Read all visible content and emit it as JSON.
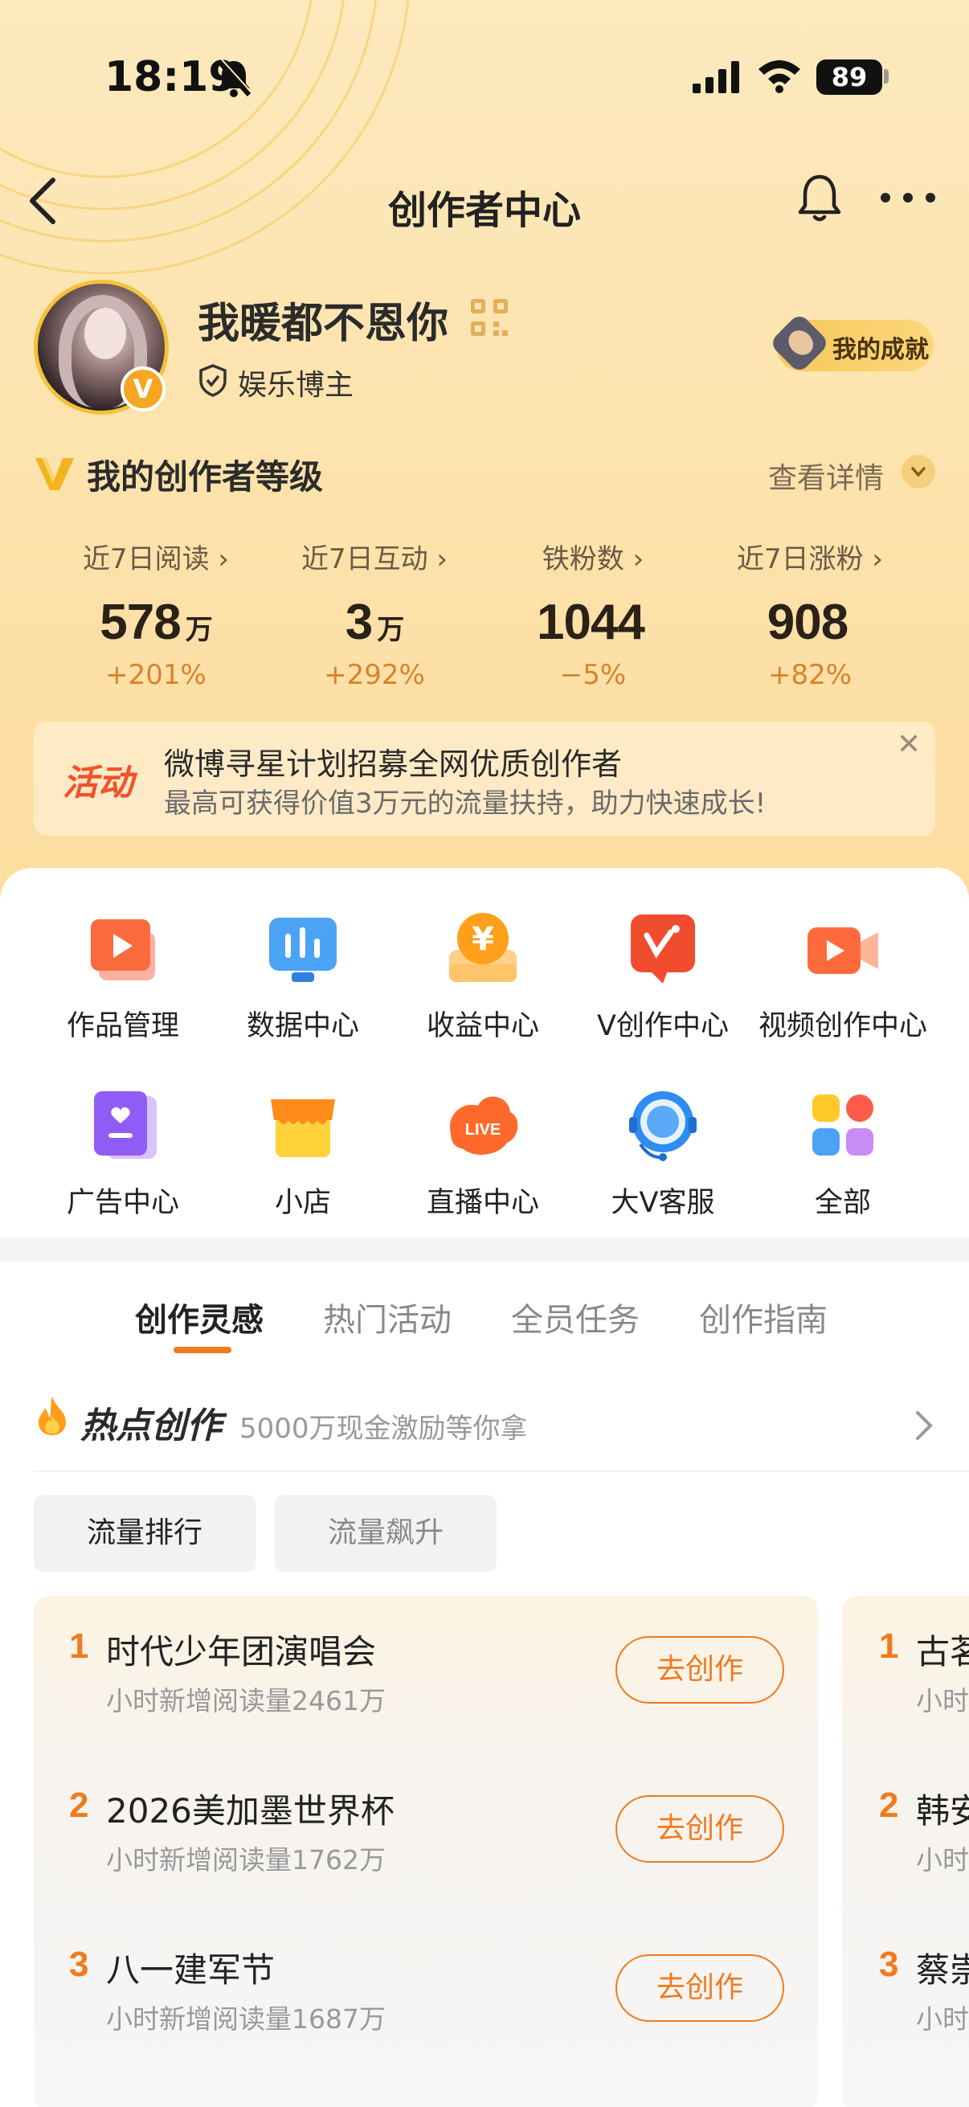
{
  "status_bar": {
    "time": "18:19",
    "battery": "89"
  },
  "nav": {
    "title": "创作者中心"
  },
  "profile": {
    "name": "我暖都不恩你",
    "role": "娱乐博主",
    "verified_badge": "V",
    "achievement_label": "我的成就"
  },
  "level": {
    "title": "我的创作者等级",
    "detail_label": "查看详情"
  },
  "stats": [
    {
      "label": "近7日阅读 ›",
      "value": "578",
      "unit": "万",
      "change": "+201%"
    },
    {
      "label": "近7日互动 ›",
      "value": "3",
      "unit": "万",
      "change": "+292%"
    },
    {
      "label": "铁粉数 ›",
      "value": "1044",
      "unit": "",
      "change": "−5%"
    },
    {
      "label": "近7日涨粉 ›",
      "value": "908",
      "unit": "",
      "change": "+82%"
    }
  ],
  "banner": {
    "tag": "活动",
    "title": "微博寻星计划招募全网优质创作者",
    "subtitle": "最高可获得价值3万元的流量扶持，助力快速成长!",
    "close": "✕"
  },
  "tools": [
    {
      "label": "作品管理",
      "icon": "works-manage-icon"
    },
    {
      "label": "数据中心",
      "icon": "data-center-icon"
    },
    {
      "label": "收益中心",
      "icon": "income-center-icon"
    },
    {
      "label": "V创作中心",
      "icon": "v-create-icon"
    },
    {
      "label": "视频创作中心",
      "icon": "video-create-icon"
    },
    {
      "label": "广告中心",
      "icon": "ad-center-icon"
    },
    {
      "label": "小店",
      "icon": "shop-icon"
    },
    {
      "label": "直播中心",
      "icon": "live-center-icon"
    },
    {
      "label": "大V客服",
      "icon": "customer-service-icon"
    },
    {
      "label": "全部",
      "icon": "all-apps-icon"
    }
  ],
  "live_badge_text": "LIVE",
  "tabs": [
    "创作灵感",
    "热门活动",
    "全员任务",
    "创作指南"
  ],
  "hot": {
    "title": "热点创作",
    "subtitle": "5000万现金激励等你拿"
  },
  "chips": [
    "流量排行",
    "流量飙升"
  ],
  "ranking": [
    {
      "rank": "1",
      "title": "时代少年团演唱会",
      "sub": "小时新增阅读量2461万",
      "button": "去创作"
    },
    {
      "rank": "2",
      "title": "2026美加墨世界杯",
      "sub": "小时新增阅读量1762万",
      "button": "去创作"
    },
    {
      "rank": "3",
      "title": "八一建军节",
      "sub": "小时新增阅读量1687万",
      "button": "去创作"
    }
  ],
  "ranking_peek": [
    {
      "rank": "1",
      "title": "古茗",
      "sub": "小时"
    },
    {
      "rank": "2",
      "title": "韩安",
      "sub": "小时"
    },
    {
      "rank": "3",
      "title": "蔡崇",
      "sub": "小时"
    }
  ],
  "colors": {
    "accent": "#f07b1d",
    "header_bg": "#fde4b0",
    "banner_tag": "#f0522b"
  }
}
